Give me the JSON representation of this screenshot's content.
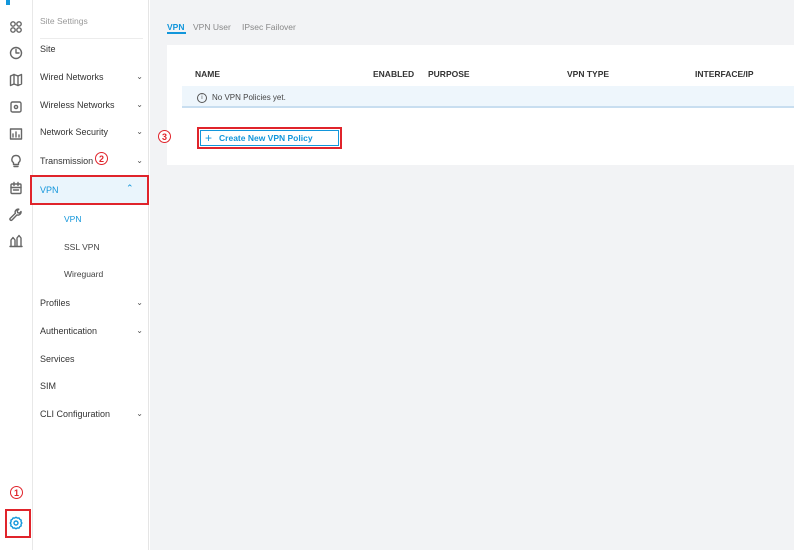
{
  "rail": {
    "icons": [
      "apps-icon",
      "clock-icon",
      "map-icon",
      "device-icon",
      "statistics-icon",
      "bulb-icon",
      "calendar-icon",
      "wrench-icon",
      "chart-icon",
      "settings-icon"
    ]
  },
  "sidebar": {
    "header": "Site Settings",
    "items": [
      {
        "label": "Site"
      },
      {
        "label": "Wired Networks",
        "chevron": "⌄"
      },
      {
        "label": "Wireless Networks",
        "chevron": "⌄"
      },
      {
        "label": "Network Security",
        "chevron": "⌄"
      },
      {
        "label": "Transmission",
        "chevron": "⌄"
      },
      {
        "label": "VPN",
        "chevron": "⌃"
      },
      {
        "label": "Profiles",
        "chevron": "⌄"
      },
      {
        "label": "Authentication",
        "chevron": "⌄"
      },
      {
        "label": "Services"
      },
      {
        "label": "SIM"
      },
      {
        "label": "CLI Configuration",
        "chevron": "⌄"
      }
    ],
    "vpn_sub": [
      "VPN",
      "SSL VPN",
      "Wireguard"
    ]
  },
  "tabs": [
    "VPN",
    "VPN User",
    "IPsec Failover"
  ],
  "table": {
    "headers": [
      "NAME",
      "ENABLED",
      "PURPOSE",
      "VPN TYPE",
      "INTERFACE/IP"
    ],
    "empty_text": "No VPN Policies yet.",
    "info_glyph": "i"
  },
  "actions": {
    "create_plus": "+",
    "create_label": "Create New VPN Policy"
  },
  "annotations": {
    "step1": "1",
    "step2": "2",
    "step3": "3"
  },
  "colors": {
    "accent": "#1296db",
    "highlight": "#e0242b",
    "background": "#f2f3f5"
  }
}
